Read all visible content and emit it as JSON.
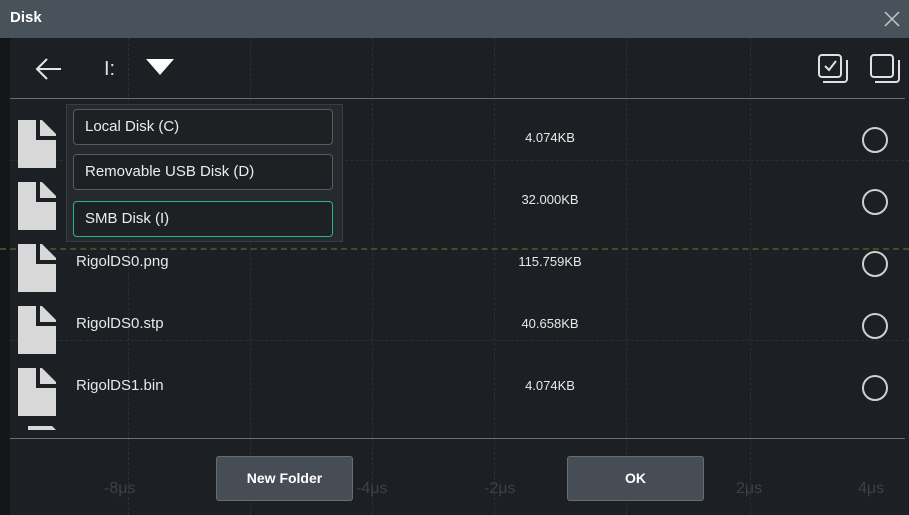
{
  "window": {
    "title": "Disk"
  },
  "toolbar": {
    "path": "I:"
  },
  "dropdown": {
    "options": [
      {
        "label": "Local Disk (C)"
      },
      {
        "label": "Removable USB Disk (D)"
      },
      {
        "label": "SMB Disk (I)"
      }
    ],
    "selected": "SMB Disk (I)",
    "accent_color": "#27b38c"
  },
  "files": [
    {
      "name": "",
      "size": "4.074KB"
    },
    {
      "name": "",
      "size": "32.000KB"
    },
    {
      "name": "RigolDS0.png",
      "size": "115.759KB"
    },
    {
      "name": "RigolDS0.stp",
      "size": "40.658KB"
    },
    {
      "name": "RigolDS1.bin",
      "size": "4.074KB"
    }
  ],
  "footer": {
    "new_folder_label": "New Folder",
    "ok_label": "OK",
    "axis_labels": [
      "-8μs",
      "-4μs",
      "-2μs",
      "2μs",
      "4μs"
    ]
  },
  "icons": {
    "back": "arrow-left-icon",
    "dropdown": "triangle-down-icon",
    "select_all": "checkbox-stack-icon",
    "deselect": "square-stack-icon",
    "close": "close-icon",
    "file": "file-icon"
  }
}
